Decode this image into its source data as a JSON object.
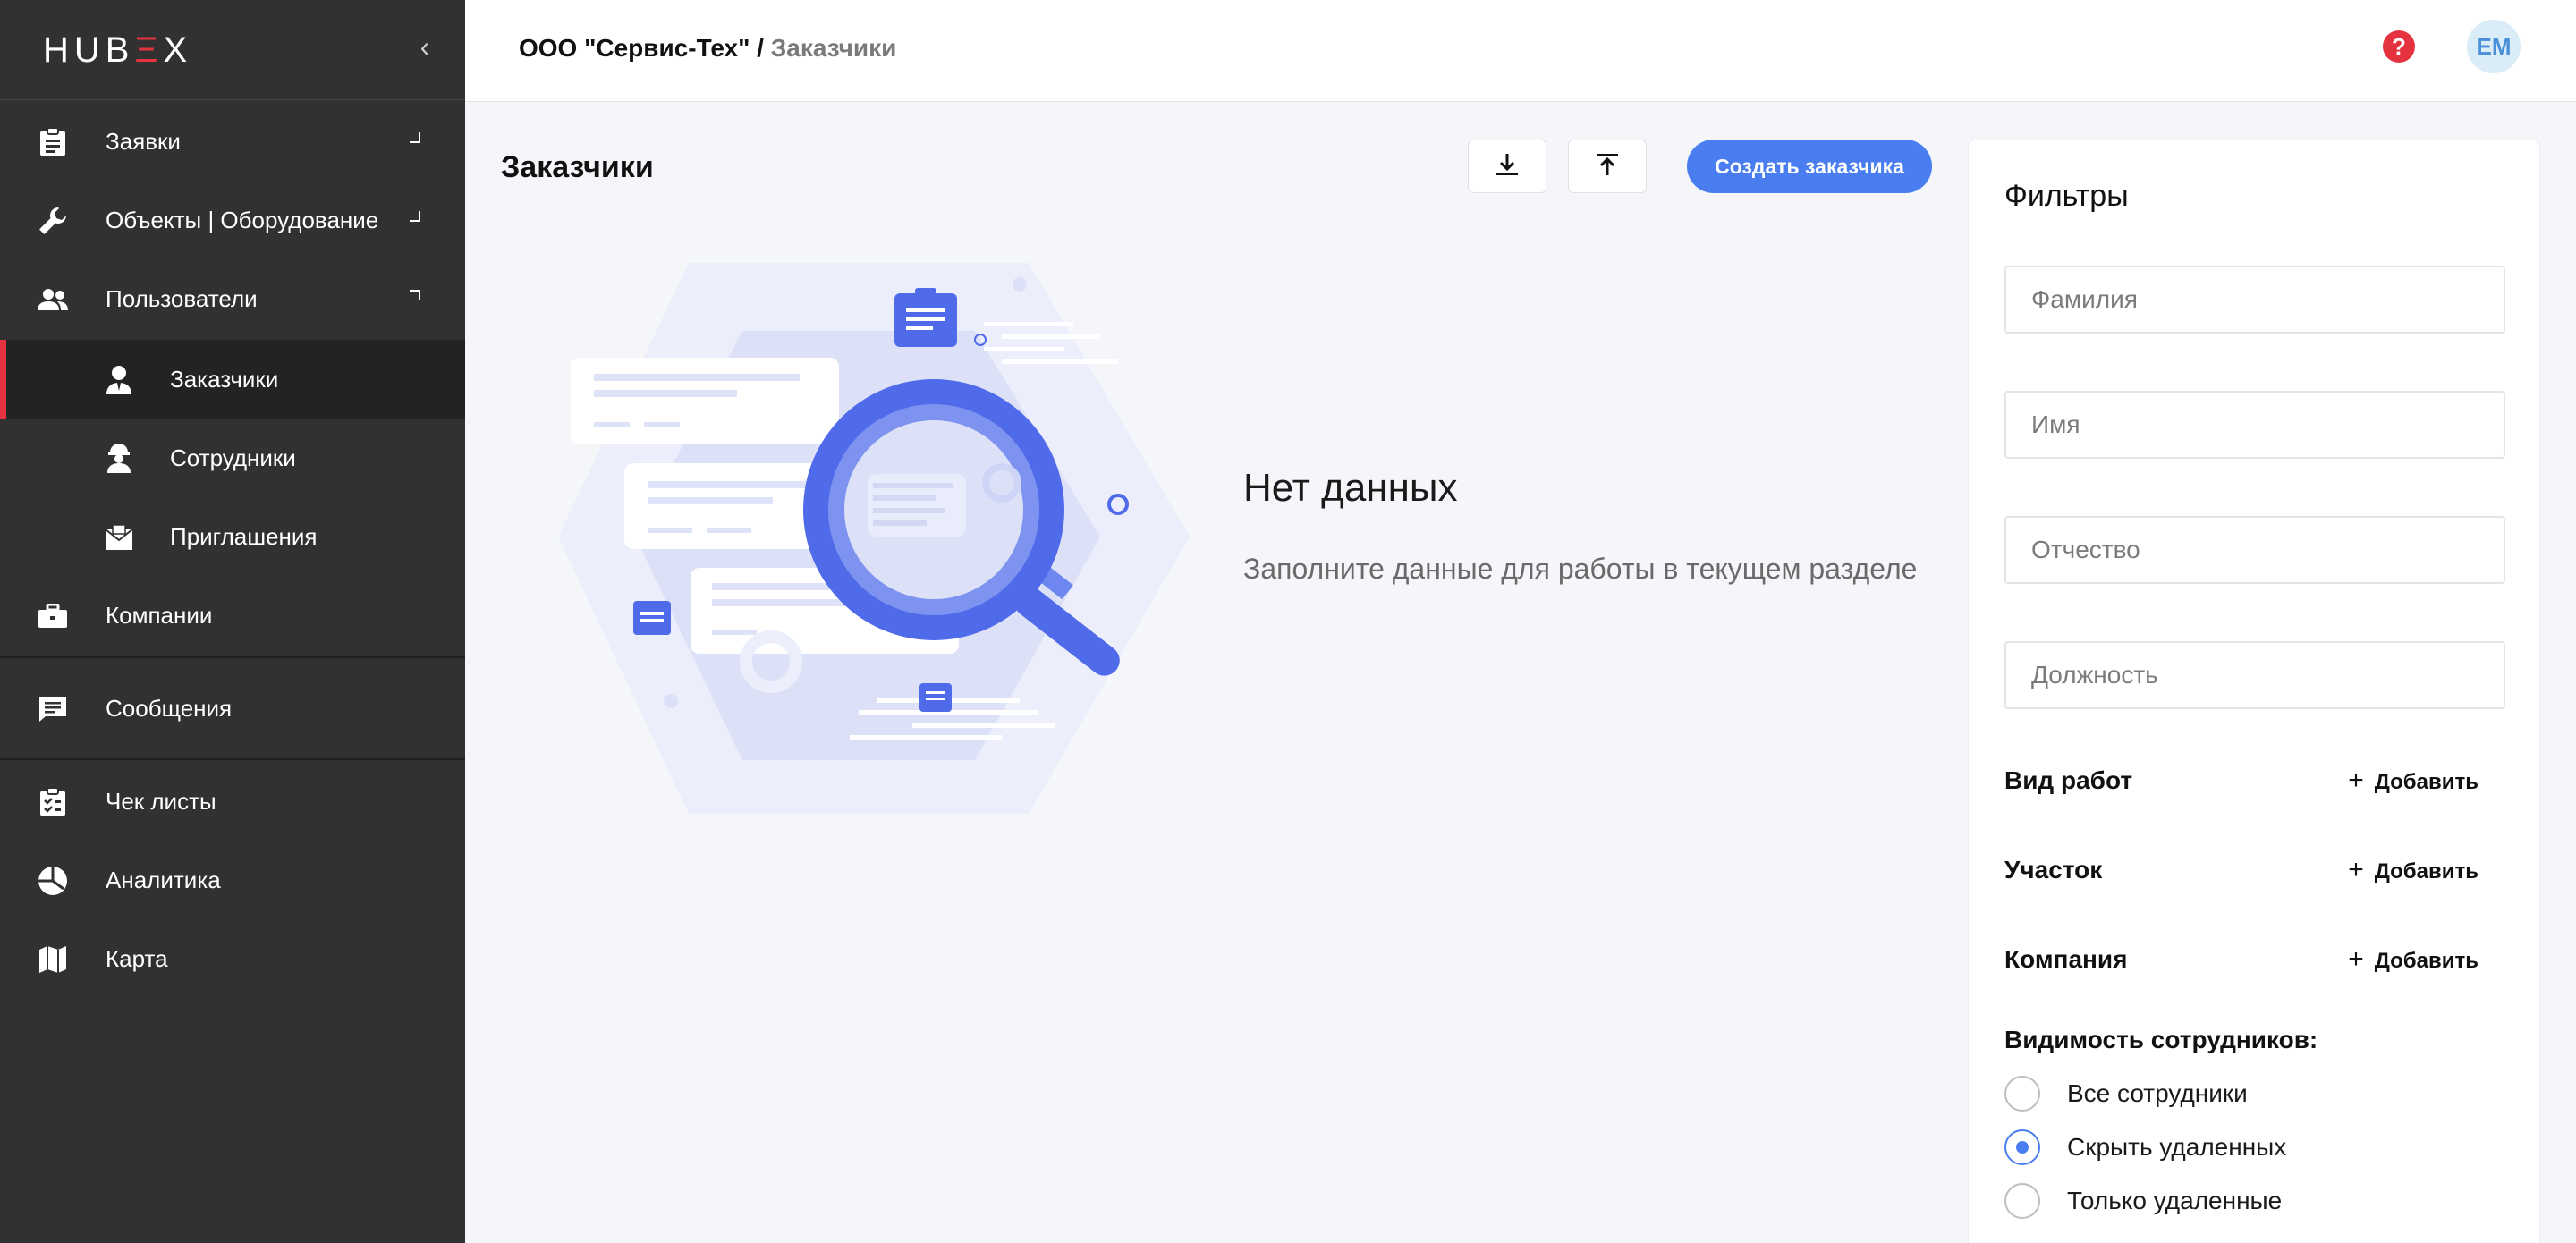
{
  "sidebar": {
    "logo": {
      "part1": "HUB",
      "part2": "Ξ",
      "part3": "X"
    },
    "collapse_glyph": "‹",
    "items": [
      {
        "label": "Заявки",
        "icon": "clipboard-icon",
        "arrow": "down"
      },
      {
        "label": "Объекты | Оборудование",
        "icon": "wrench-icon",
        "arrow": "down"
      },
      {
        "label": "Пользователи",
        "icon": "users-icon",
        "arrow": "up"
      },
      {
        "label": "Заказчики",
        "icon": "customer-icon",
        "sub": true,
        "active": true
      },
      {
        "label": "Сотрудники",
        "icon": "worker-icon",
        "sub": true
      },
      {
        "label": "Приглашения",
        "icon": "envelope-icon",
        "sub": true
      },
      {
        "label": "Компании",
        "icon": "briefcase-icon"
      },
      {
        "label": "Сообщения",
        "icon": "chat-icon"
      },
      {
        "label": "Чек листы",
        "icon": "checklist-icon"
      },
      {
        "label": "Аналитика",
        "icon": "pie-chart-icon"
      },
      {
        "label": "Карта",
        "icon": "map-icon"
      }
    ]
  },
  "header": {
    "org": "ООО \"Сервис-Тех\"",
    "separator": "/",
    "current": "Заказчики",
    "help_glyph": "?",
    "avatar_initials": "ЕМ"
  },
  "main": {
    "title": "Заказчики",
    "download_icon": "download-icon",
    "upload_icon": "upload-icon",
    "create_button": "Создать заказчика",
    "empty_title": "Нет данных",
    "empty_subtitle": "Заполните данные для работы в текущем разделе"
  },
  "filters": {
    "title": "Фильтры",
    "last_name_placeholder": "Фамилия",
    "first_name_placeholder": "Имя",
    "patronymic_placeholder": "Отчество",
    "position_placeholder": "Должность",
    "rows": [
      {
        "label": "Вид работ",
        "action": "Добавить"
      },
      {
        "label": "Участок",
        "action": "Добавить"
      },
      {
        "label": "Компания",
        "action": "Добавить"
      }
    ],
    "plus_glyph": "+",
    "visibility_title": "Видимость сотрудников:",
    "visibility_options": [
      {
        "label": "Все сотрудники",
        "selected": false
      },
      {
        "label": "Скрыть удаленных",
        "selected": true
      },
      {
        "label": "Только удаленные",
        "selected": false
      }
    ]
  },
  "colors": {
    "sidebar_bg": "#313131",
    "accent_red": "#e5323f",
    "primary_blue": "#4a7ef0",
    "illustration_blue": "#4f6bea"
  }
}
